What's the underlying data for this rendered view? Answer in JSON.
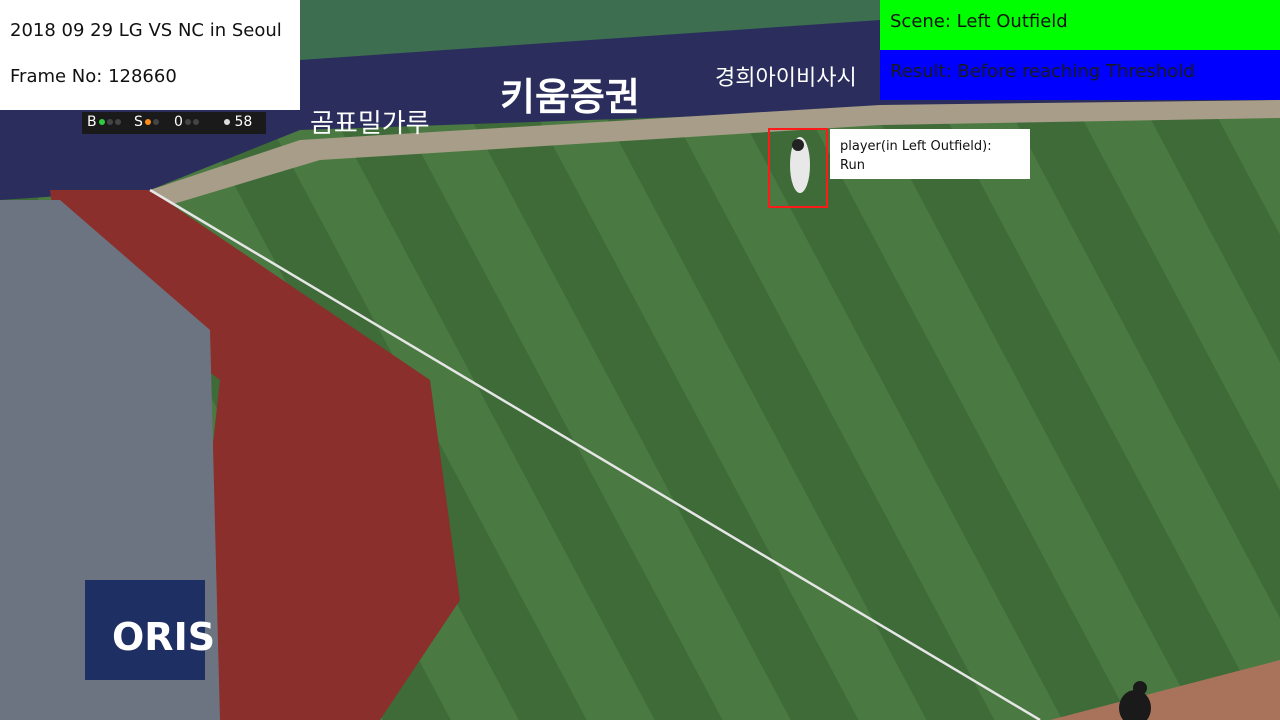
{
  "info": {
    "title": "2018 09 29 LG VS NC in Seoul",
    "frame": "Frame No: 128660"
  },
  "scene": {
    "label": "Scene: Left Outfield",
    "color": "#00ff00"
  },
  "result": {
    "label": "Result: Before reaching Threshold",
    "color": "#0000ff"
  },
  "detection": {
    "label_line1": "player(in Left Outfield):",
    "label_line2": "Run",
    "box_color": "#ff1a1a"
  },
  "scoreboard": {
    "ball_label": "B",
    "strike_label": "S",
    "outs": "0",
    "pitch_count": "58"
  },
  "signage": {
    "ad1": "키움증권",
    "ad2": "곰표밀가루",
    "ad3": "ORIS",
    "ad4": "경희아이비사시"
  }
}
